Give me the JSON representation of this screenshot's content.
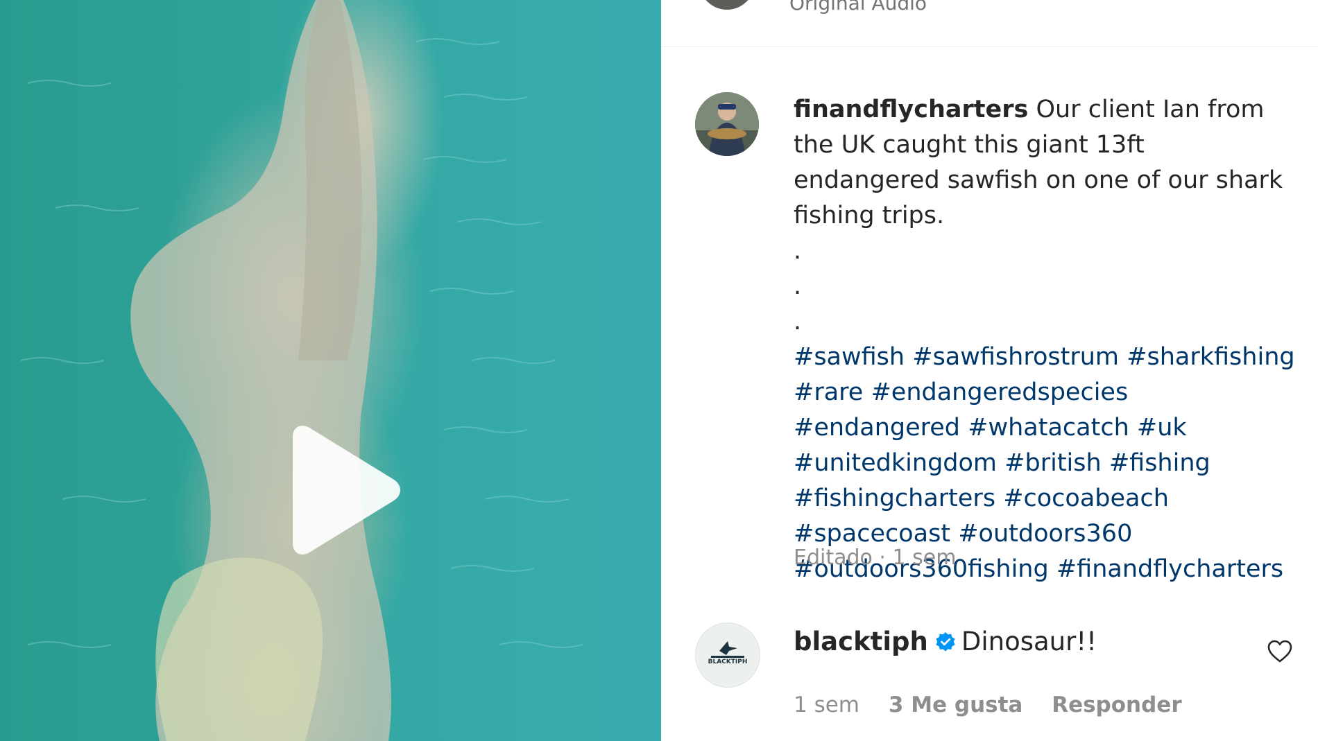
{
  "header": {
    "audio_label": "Original Audio"
  },
  "post": {
    "username": "finandflycharters",
    "caption": "Our client Ian from the UK caught this giant 13ft endangered sawfish on one of our shark fishing trips.",
    "dots": [
      ".",
      ".",
      "."
    ],
    "hashtags": [
      "#sawfish",
      "#sawfishrostrum",
      "#sharkfishing",
      "#rare",
      "#endangeredspecies",
      "#endangered",
      "#whatacatch",
      "#uk",
      "#unitedkingdom",
      "#british",
      "#fishing",
      "#fishingcharters",
      "#cocoabeach",
      "#spacecoast",
      "#outdoors360",
      "#outdoors360fishing",
      "#finandflycharters"
    ],
    "edited_label": "Editado",
    "separator": " · ",
    "time": "1 sem"
  },
  "comment": {
    "username": "blacktiph",
    "verified": true,
    "text": "Dinosaur!!",
    "avatar_logo_text": "BLACKTIPH",
    "time": "1 sem",
    "likes": "3 Me gusta",
    "reply_label": "Responder"
  },
  "colors": {
    "hashtag": "#00376b",
    "verified": "#0095f6",
    "muted": "#8e8e8e"
  },
  "icons": {
    "play": "play-icon",
    "like": "heart-outline-icon",
    "verified": "verified-badge-icon"
  }
}
